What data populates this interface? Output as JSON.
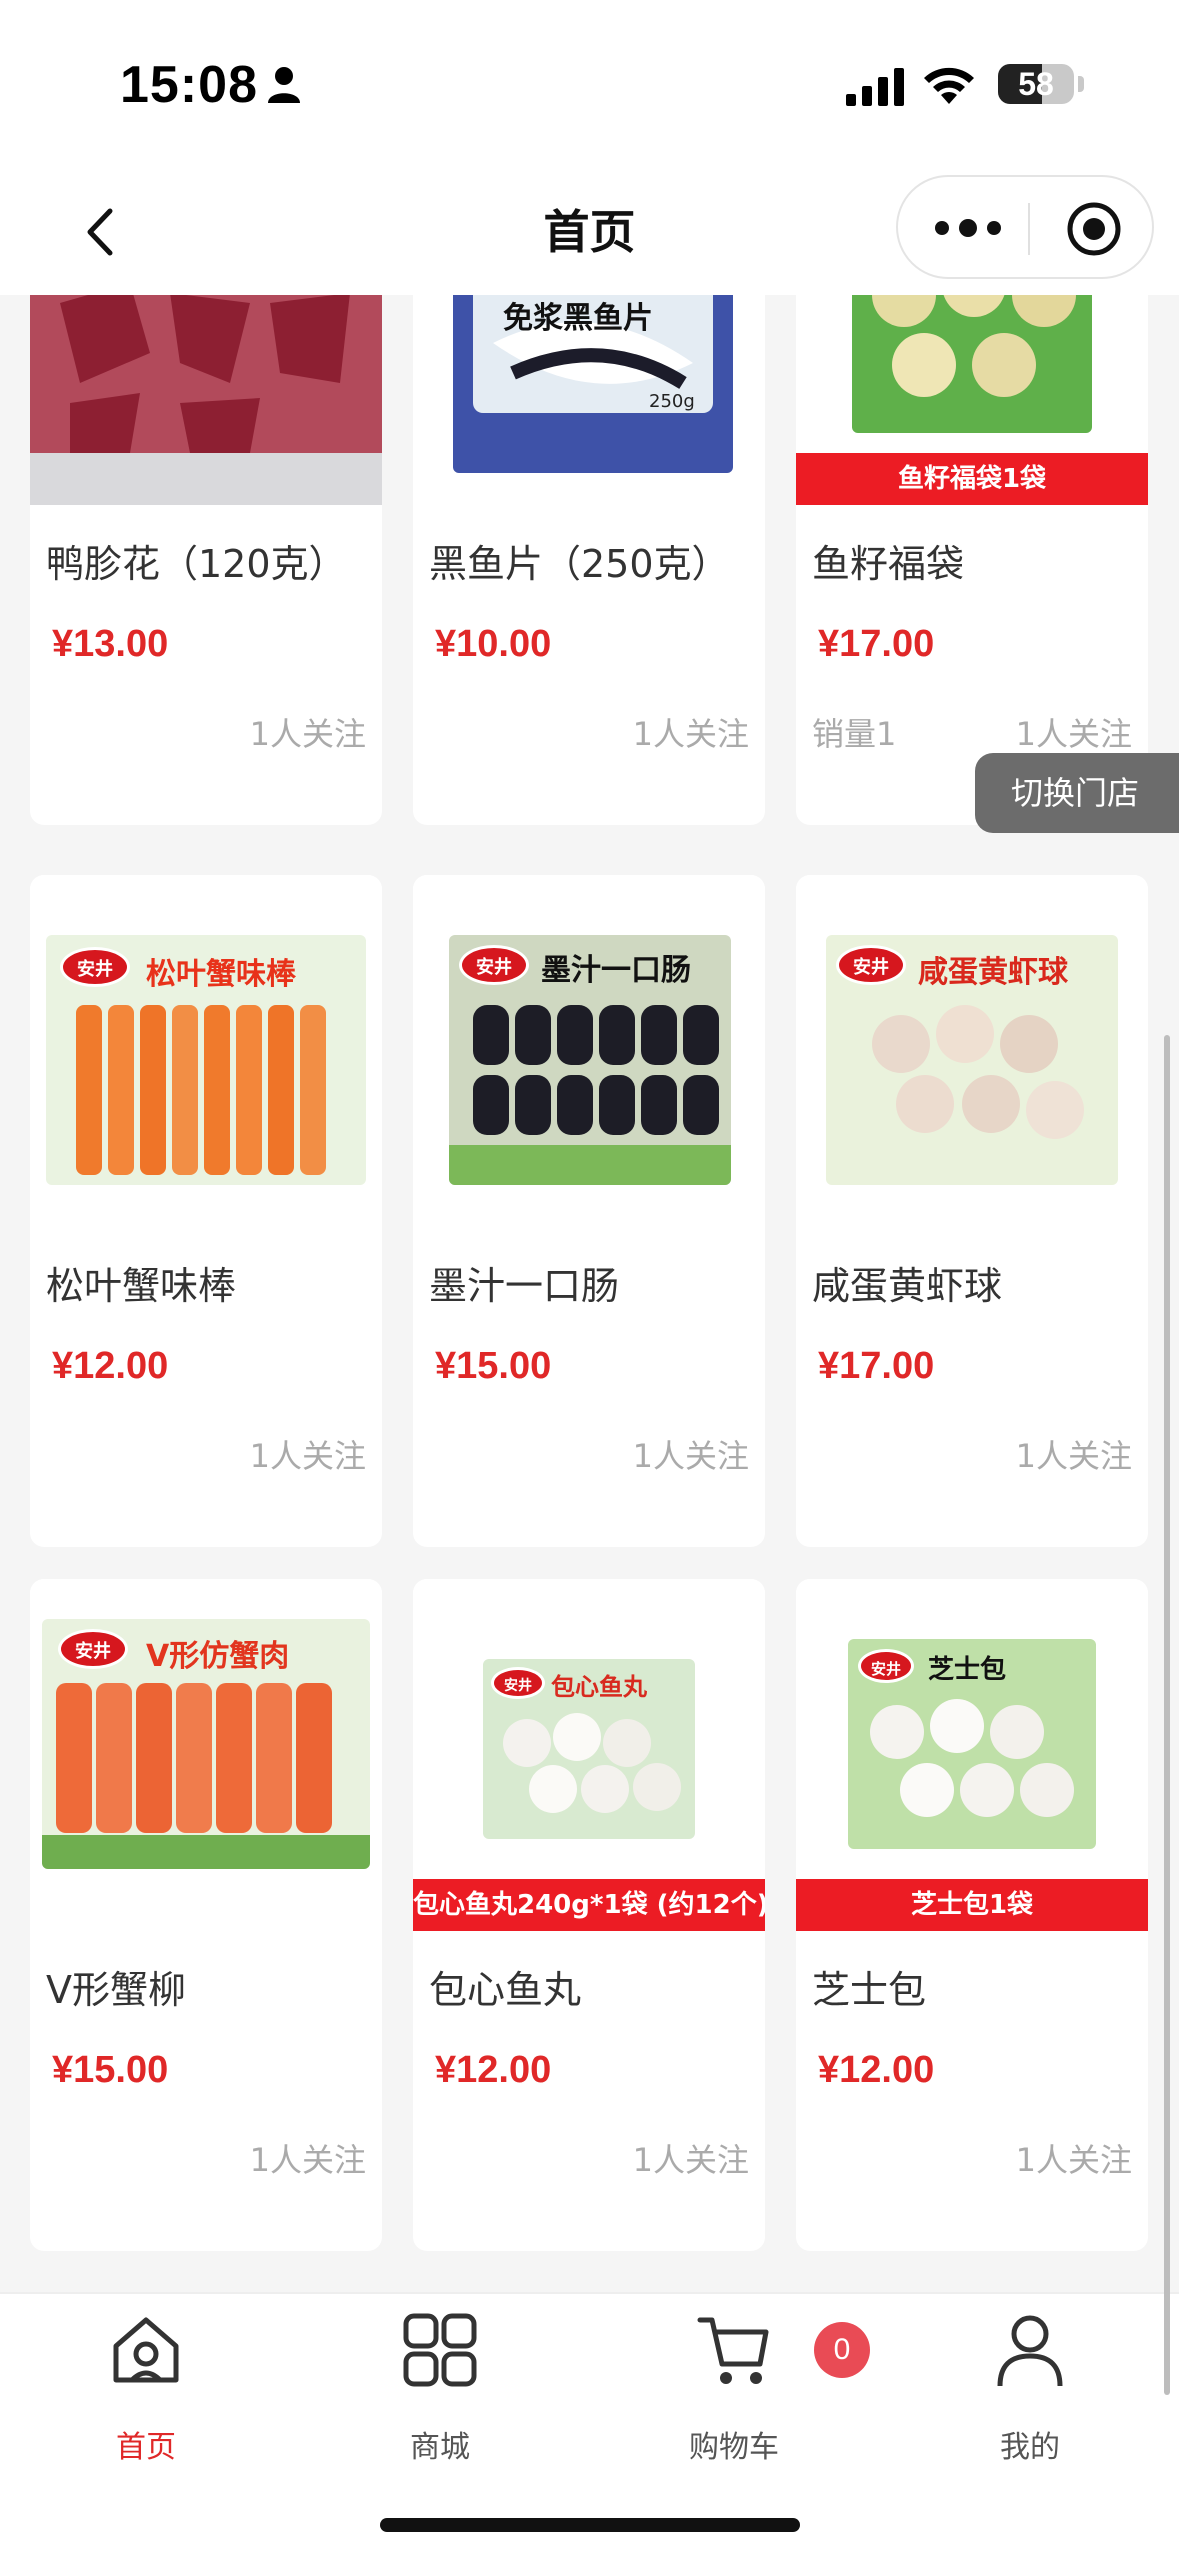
{
  "status_bar": {
    "time": "15:08",
    "battery": "58",
    "battery_level": 0.58
  },
  "nav": {
    "title": "首页"
  },
  "products": [
    {
      "name": "鸭胗花（120克）",
      "price": "¥13.00",
      "followers": "1人关注"
    },
    {
      "name": "黑鱼片（250克）",
      "price": "¥10.00",
      "followers": "1人关注",
      "pack_title": "免浆黑鱼片",
      "pack_weight": "250g"
    },
    {
      "name": "鱼籽福袋",
      "price": "¥17.00",
      "sales": "销量1",
      "followers": "1人关注",
      "banner": "鱼籽福袋1袋"
    },
    {
      "name": "松叶蟹味棒",
      "price": "¥12.00",
      "followers": "1人关注",
      "pack_title": "松叶蟹味棒",
      "brand": "安井"
    },
    {
      "name": "墨汁一口肠",
      "price": "¥15.00",
      "followers": "1人关注",
      "pack_title": "墨汁一口肠",
      "brand": "安井"
    },
    {
      "name": "咸蛋黄虾球",
      "price": "¥17.00",
      "followers": "1人关注",
      "pack_title": "咸蛋黄虾球",
      "brand": "安井"
    },
    {
      "name": "V形蟹柳",
      "price": "¥15.00",
      "followers": "1人关注",
      "pack_title": "V形仿蟹肉",
      "brand": "安井"
    },
    {
      "name": "包心鱼丸",
      "price": "¥12.00",
      "followers": "1人关注",
      "pack_title": "包心鱼丸",
      "brand": "安井",
      "banner": "包心鱼丸240g*1袋 (约12个)"
    },
    {
      "name": "芝士包",
      "price": "¥12.00",
      "followers": "1人关注",
      "pack_title": "芝士包",
      "brand": "安井",
      "banner": "芝士包1袋"
    }
  ],
  "switch_store": "切换门店",
  "tabs": [
    {
      "label": "首页",
      "icon": "home-icon",
      "active": true
    },
    {
      "label": "商城",
      "icon": "grid-icon"
    },
    {
      "label": "购物车",
      "icon": "cart-icon"
    },
    {
      "label": "我的",
      "icon": "user-icon"
    }
  ],
  "cart_count": "0",
  "colors": {
    "price": "#e02828",
    "banner": "#ec1c24",
    "active_tab": "#e02828",
    "badge": "#e94b55"
  }
}
